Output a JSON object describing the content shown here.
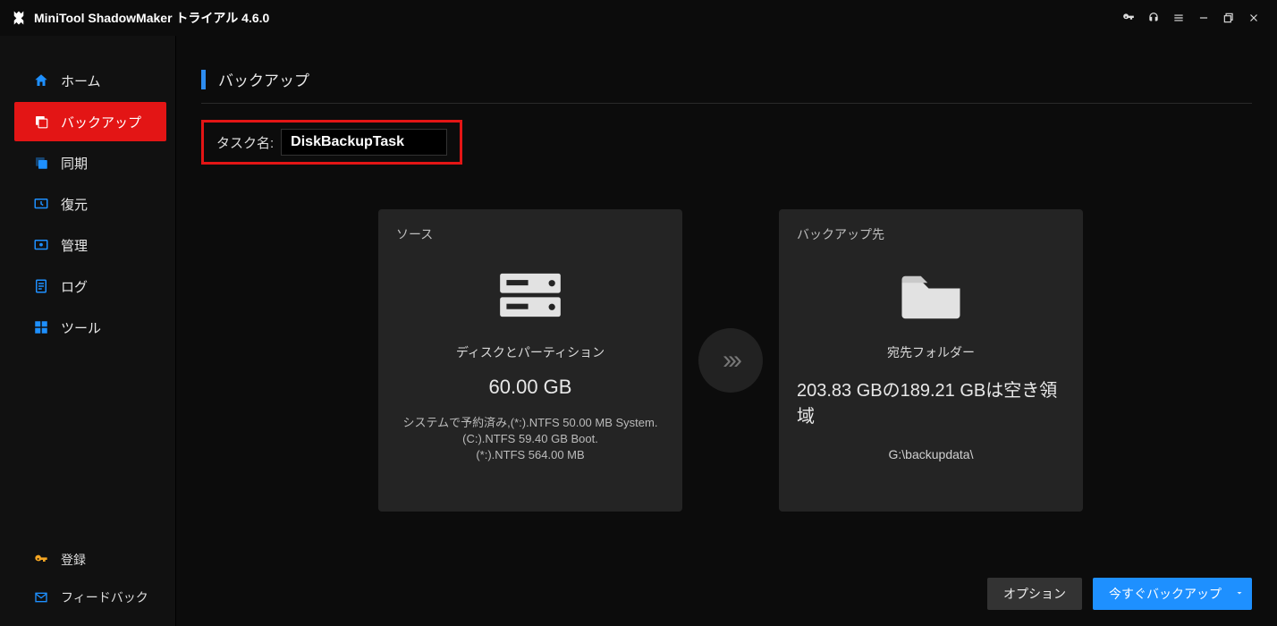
{
  "titlebar": {
    "title": "MiniTool ShadowMaker トライアル 4.6.0"
  },
  "sidebar": {
    "items": [
      {
        "label": "ホーム"
      },
      {
        "label": "バックアップ"
      },
      {
        "label": "同期"
      },
      {
        "label": "復元"
      },
      {
        "label": "管理"
      },
      {
        "label": "ログ"
      },
      {
        "label": "ツール"
      }
    ],
    "bottom": [
      {
        "label": "登録"
      },
      {
        "label": "フィードバック"
      }
    ]
  },
  "page": {
    "title": "バックアップ"
  },
  "task": {
    "label": "タスク名:",
    "value": "DiskBackupTask"
  },
  "source": {
    "header": "ソース",
    "subtitle": "ディスクとパーティション",
    "size": "60.00 GB",
    "detail": "システムで予約済み,(*:).NTFS 50.00 MB System.\n(C:).NTFS 59.40 GB Boot.\n(*:).NTFS 564.00 MB"
  },
  "destination": {
    "header": "バックアップ先",
    "subtitle": "宛先フォルダー",
    "summary": "203.83 GBの189.21 GBは空き領域",
    "path": "G:\\backupdata\\"
  },
  "footer": {
    "option": "オプション",
    "backup_now": "今すぐバックアップ"
  }
}
